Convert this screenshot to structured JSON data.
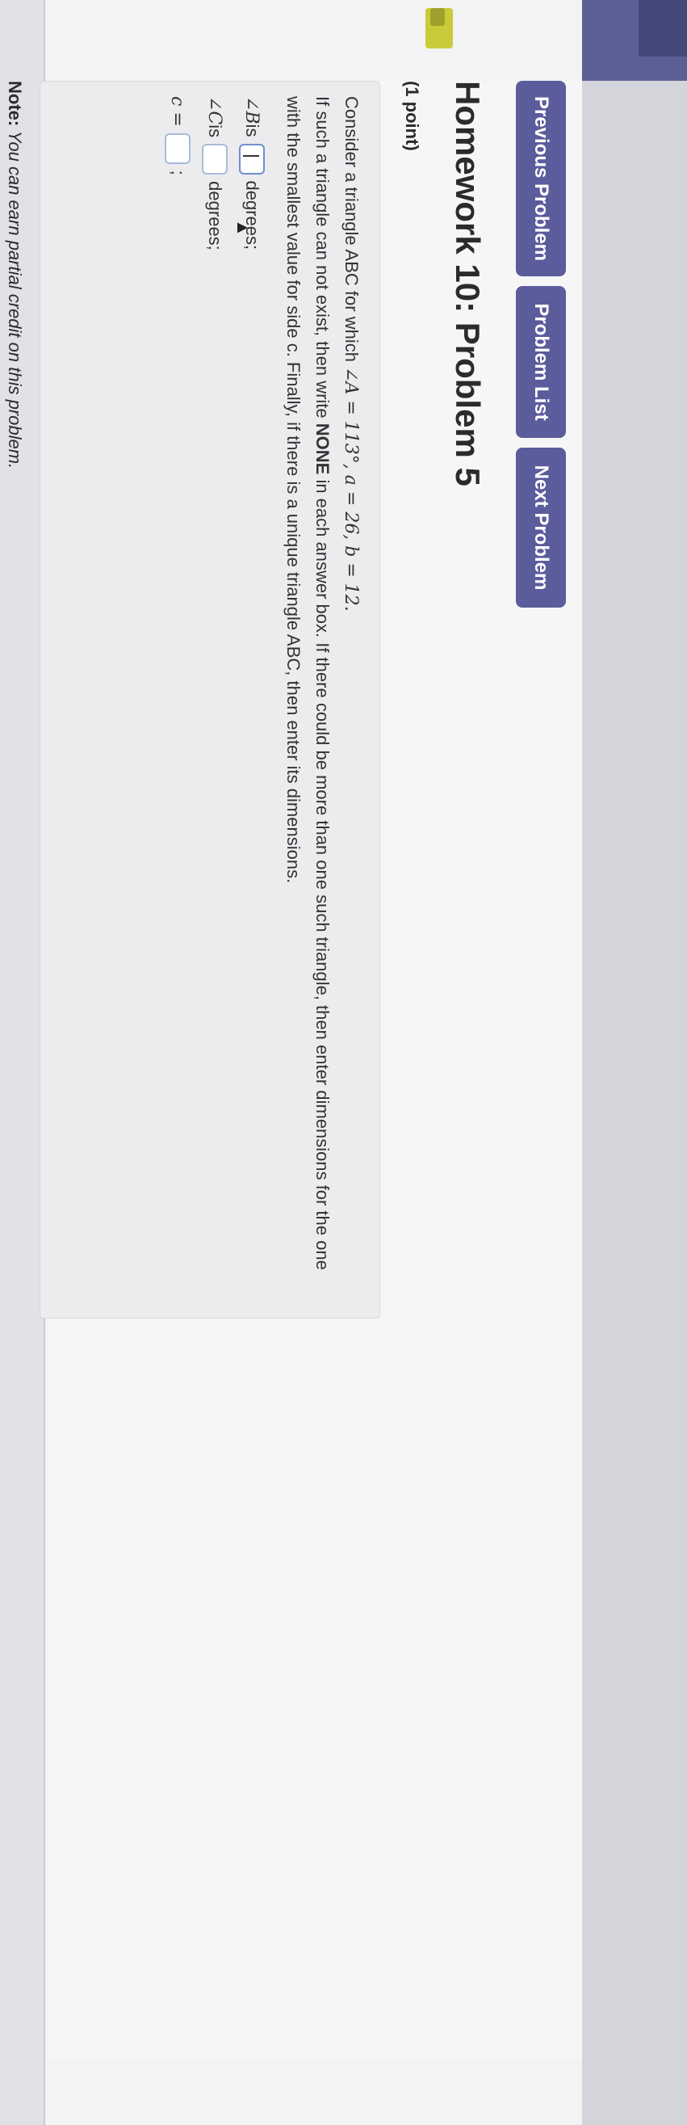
{
  "nav": {
    "previous_label": "Previous Problem",
    "list_label": "Problem List",
    "next_label": "Next Problem"
  },
  "header": {
    "title": "Homework 10: Problem 5",
    "points": "(1 point)"
  },
  "problem": {
    "line1_prefix": "Consider a triangle ABC for which ",
    "line1_math": "∠A = 113°, a = 26, b = 12.",
    "line2_before": "If such a triangle can not exist, then write ",
    "line2_bold": "NONE",
    "line2_after": " in each answer box. If there could be more than one such triangle, then enter dimensions for the one",
    "line3": "with the smallest value for side c. Finally, if there is a unique triangle ABC, then enter its dimensions.",
    "answers": [
      {
        "label_math": "∠B",
        "label_text": " is",
        "suffix": "degrees;"
      },
      {
        "label_math": "∠C",
        "label_text": " is",
        "suffix": "degrees;"
      },
      {
        "label_math": "c =",
        "label_text": "",
        "suffix": ";"
      }
    ]
  },
  "note": {
    "bold": "Note:",
    "text": " You can earn partial credit on this problem."
  },
  "colors": {
    "nav_button": "#5b5c9c",
    "input_border": "#a8bad8",
    "accent_tab": "#c9cb3a"
  }
}
